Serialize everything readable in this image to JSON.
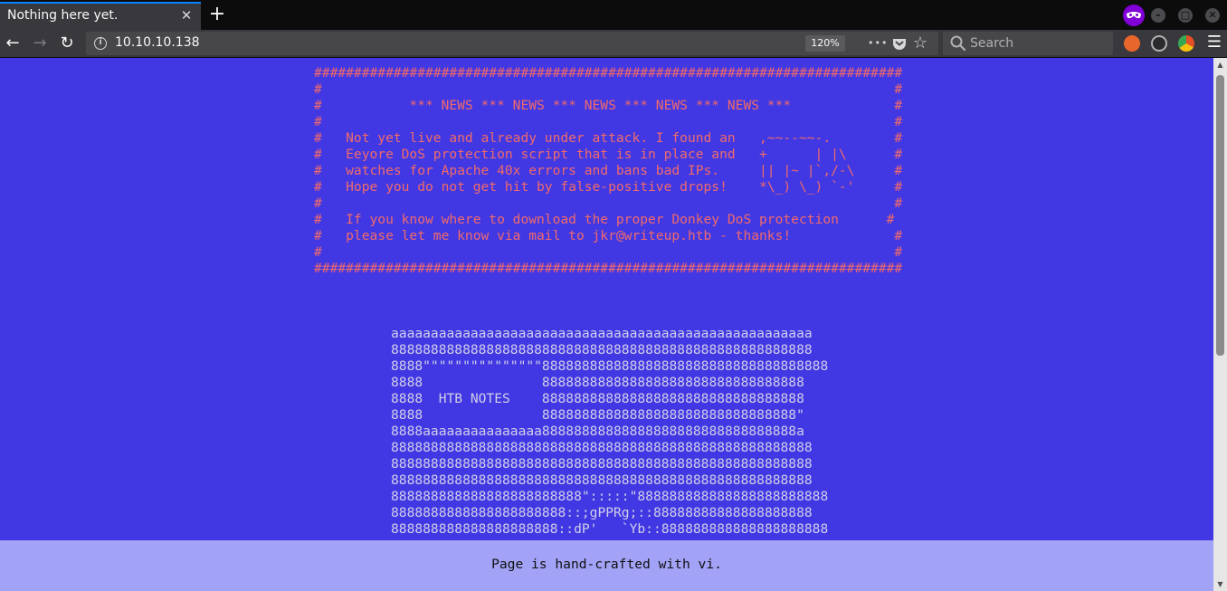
{
  "browser": {
    "tab": {
      "title": "Nothing here yet.",
      "close_glyph": "✕"
    },
    "new_tab_glyph": "+",
    "window_controls": {
      "minimize": "–",
      "maximize": "□",
      "close": "✕"
    },
    "nav": {
      "back": "←",
      "forward": "→",
      "reload": "↻"
    },
    "url": "10.10.10.138",
    "zoom": "120%",
    "page_actions": {
      "more": "•••",
      "star": "☆"
    },
    "search": {
      "placeholder": "Search"
    },
    "menu": "☰"
  },
  "page": {
    "news_block": "##########################################################################\n#                                                                        #\n#           *** NEWS *** NEWS *** NEWS *** NEWS *** NEWS ***             #\n#                                                                        #\n#   Not yet live and already under attack. I found an   ,~~--~~-.        #\n#   Eeyore DoS protection script that is in place and   +      | |\\      #\n#   watches for Apache 40x errors and bans bad IPs.     || |~ |`,/-\\     #\n#   Hope you do not get hit by false-positive drops!    *\\_) \\_) `-'     #\n#                                                                        #\n#   If you know where to download the proper Donkey DoS protection      #\n#   please let me know via mail to jkr@writeup.htb - thanks!             #\n#                                                                        #\n##########################################################################",
    "ascii_art": "aaaaaaaaaaaaaaaaaaaaaaaaaaaaaaaaaaaaaaaaaaaaaaaaaaaaa\n88888888888888888888888888888888888888888888888888888\n8888\"\"\"\"\"\"\"\"\"\"\"\"\"\"\"888888888888888888888888888888888888\n8888               888888888888888888888888888888888\n8888  HTB NOTES    888888888888888888888888888888888\n8888               88888888888888888888888888888888\"\n8888aaaaaaaaaaaaaaa88888888888888888888888888888888a\n88888888888888888888888888888888888888888888888888888\n88888888888888888888888888888888888888888888888888888\n88888888888888888888888888888888888888888888888888888\n888888888888888888888888\":::::\"888888888888888888888888\n8888888888888888888888::;gPPRg;::88888888888888888888\n888888888888888888888::dP'   `Yb::888888888888888888888",
    "footer": "Page is hand-crafted with vi."
  },
  "colors": {
    "page_background": "#4238e3",
    "news_text": "#f06a6a",
    "art_text": "#cfcfe8",
    "footer_background": "#a2a2f6"
  },
  "icons": [
    "private-browsing-icon",
    "info-icon",
    "pocket-icon",
    "bookmark-star-icon",
    "search-icon",
    "extension-icon",
    "menu-icon"
  ]
}
